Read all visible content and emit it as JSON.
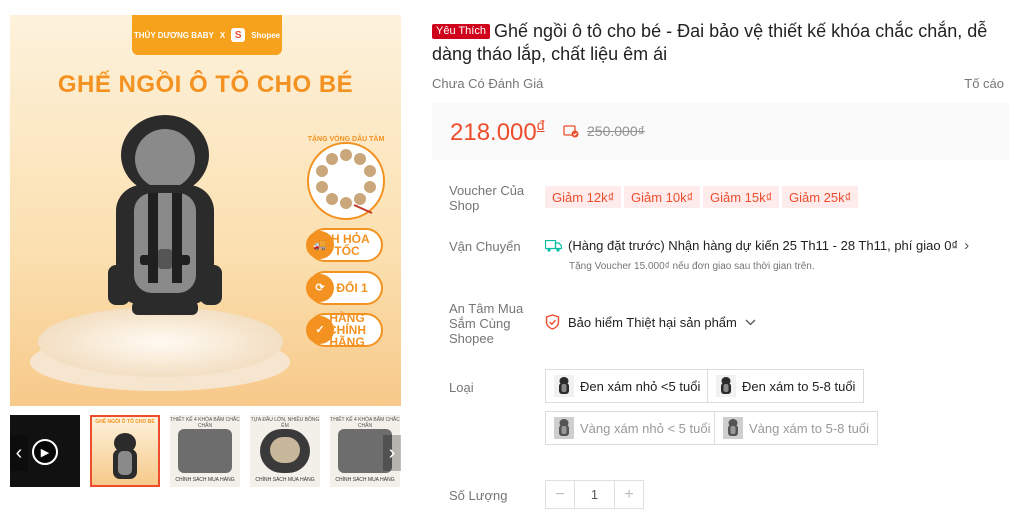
{
  "gallery": {
    "brand_name": "THỦY DƯƠNG BABY",
    "brand_x": "X",
    "shopee_label": "Shopee",
    "hero_title": "GHẾ NGỒI Ô TÔ CHO BÉ",
    "gift_label": "TẶNG VÒNG DÂU TẰM",
    "badges": [
      {
        "icon": "truck-icon",
        "text": "2H HỎA TỐC"
      },
      {
        "icon": "exchange-icon",
        "text": "1 ĐỔI 1"
      },
      {
        "icon": "shield-check-icon",
        "text": "HÀNG CHÍNH HÃNG"
      }
    ],
    "thumbnails": [
      {
        "type": "video",
        "top": "",
        "caption": ""
      },
      {
        "type": "image",
        "top": "GHẾ NGỒI Ô TÔ CHO BÉ",
        "caption": ""
      },
      {
        "type": "image",
        "top": "THIẾT KẾ 4 KHÓA BẤM CHẮC CHẮN",
        "caption": "CHÍNH SÁCH MUA HÀNG"
      },
      {
        "type": "image",
        "top": "TỰA ĐẦU LỚN, NHIỀU BÔNG ÊM",
        "caption": "CHÍNH SÁCH MUA HÀNG"
      },
      {
        "type": "image",
        "top": "THIẾT KẾ 4 KHÓA BẤM CHẮC CHẮN",
        "caption": "CHÍNH SÁCH MUA HÀNG"
      }
    ],
    "prev_arrow": "‹",
    "next_arrow": "›"
  },
  "product": {
    "favorite_badge": "Yêu Thích",
    "title": "Ghế ngồi ô tô cho bé - Đai bảo vệ thiết kế khóa chắc chắn, dễ dàng tháo lắp, chất liệu êm ái",
    "rating_text": "Chưa Có Đánh Giá",
    "report_text": "Tố cáo",
    "price": "218.000",
    "price_currency": "đ",
    "old_price": "250.000₫"
  },
  "voucher": {
    "label": "Voucher Của Shop",
    "chips": [
      "Giảm 12k₫",
      "Giảm 10k₫",
      "Giảm 15k₫",
      "Giảm 25k₫"
    ]
  },
  "shipping": {
    "label": "Vận Chuyển",
    "line": "(Hàng đặt trước) Nhận hàng dự kiến 25 Th11 - 28 Th11, phí giao 0₫",
    "sub": "Tặng Voucher 15.000₫ nếu đơn giao sau thời gian trên."
  },
  "assurance": {
    "label": "An Tâm Mua Sắm Cùng Shopee",
    "text": "Bảo hiểm Thiệt hại sản phẩm"
  },
  "variants": {
    "label": "Loại",
    "options": [
      {
        "text": "Đen xám nhỏ <5 tuổi",
        "available": true
      },
      {
        "text": "Đen xám to 5-8 tuổi",
        "available": true
      },
      {
        "text": "Vàng xám nhỏ < 5 tuổi",
        "available": false
      },
      {
        "text": "Vàng xám to 5-8 tuổi",
        "available": false
      }
    ]
  },
  "quantity": {
    "label": "Số Lượng",
    "value": "1",
    "minus": "−",
    "plus": "+"
  },
  "colors": {
    "accent": "#ee4d2d",
    "brand_orange": "#f39221",
    "favorite_red": "#d0011b"
  }
}
